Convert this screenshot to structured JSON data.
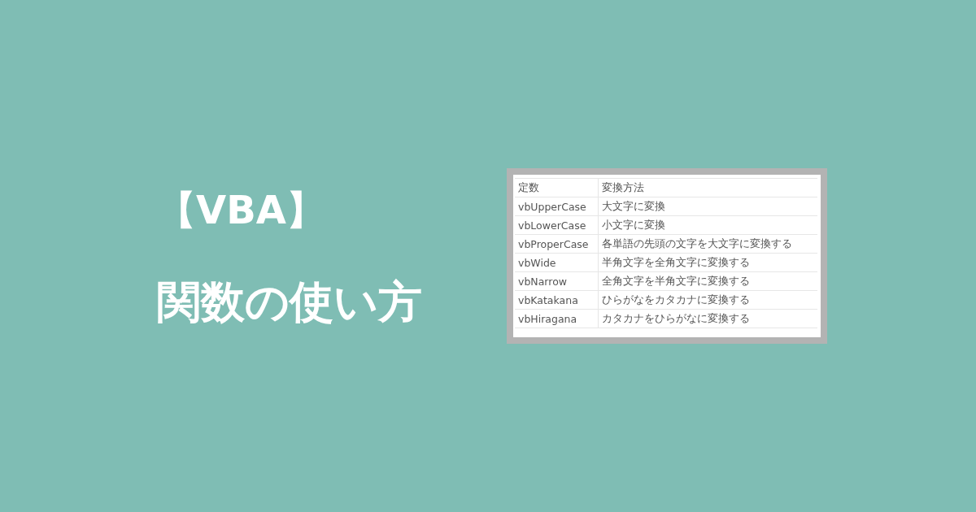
{
  "title": {
    "lines": [
      "【VBA】",
      "関数の使い方"
    ]
  },
  "table": {
    "columns": [
      "定数",
      "変換方法"
    ],
    "rows": [
      [
        "vbUpperCase",
        "大文字に変換"
      ],
      [
        "vbLowerCase",
        "小文字に変換"
      ],
      [
        "vbProperCase",
        "各単語の先頭の文字を大文字に変換する"
      ],
      [
        "vbWide",
        "半角文字を全角文字に変換する"
      ],
      [
        "vbNarrow",
        "全角文字を半角文字に変換する"
      ],
      [
        "vbKatakana",
        "ひらがなをカタカナに変換する"
      ],
      [
        "vbHiragana",
        "カタカナをひらがなに変換する"
      ]
    ]
  }
}
